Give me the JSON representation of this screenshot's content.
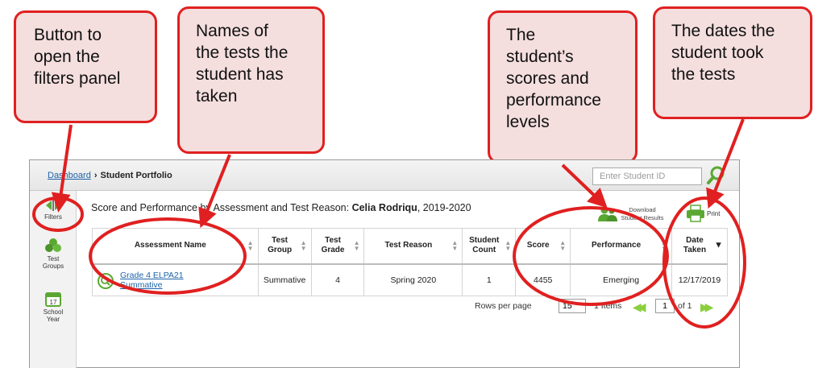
{
  "callouts": {
    "filters": [
      "Button to",
      "open the",
      "filters panel"
    ],
    "names": [
      "Names of",
      "the tests the",
      "student has",
      "taken"
    ],
    "scores": [
      "The",
      "student’s",
      "scores and",
      "performance",
      "levels"
    ],
    "dates": [
      "The dates the",
      "student took",
      "the tests"
    ]
  },
  "header": {
    "breadcrumb_link": "Dashboard",
    "breadcrumb_current": "Student Portfolio",
    "student_id_placeholder": "Enter Student ID"
  },
  "rail": {
    "filters": "Filters",
    "test_groups": [
      "Test",
      "Groups"
    ],
    "school_year": [
      "School",
      "Year"
    ],
    "calendar_day": "17"
  },
  "results": {
    "title_prefix": "Score and Performance by Assessment and Test Reason: ",
    "student_name": "Celia Rodriqu",
    "title_suffix": ", 2019-2020",
    "download_label": [
      "Download",
      "Student Results"
    ],
    "print_label": "Print"
  },
  "table": {
    "headers": {
      "assessment": "Assessment Name",
      "group": [
        "Test",
        "Group"
      ],
      "grade": [
        "Test",
        "Grade"
      ],
      "reason": "Test Reason",
      "count": [
        "Student",
        "Count"
      ],
      "score": "Score",
      "performance": "Performance",
      "date": [
        "Date",
        "Taken"
      ]
    },
    "rows": [
      {
        "assessment": [
          "Grade 4 ELPA21",
          "Summative"
        ],
        "group": "Summative",
        "grade": "4",
        "reason": "Spring 2020",
        "count": "1",
        "score": "4455",
        "performance": "Emerging",
        "date": "12/17/2019"
      }
    ]
  },
  "pagination": {
    "rows_label": "Rows per page",
    "rows_value": "15",
    "items_label": "1 Items",
    "page_value": "1",
    "of_label": "of 1"
  },
  "colors": {
    "callout_fill": "#f4dede",
    "annotation_red": "#e02020",
    "link_blue": "#1d63a8",
    "accent_green": "#5aa832"
  }
}
